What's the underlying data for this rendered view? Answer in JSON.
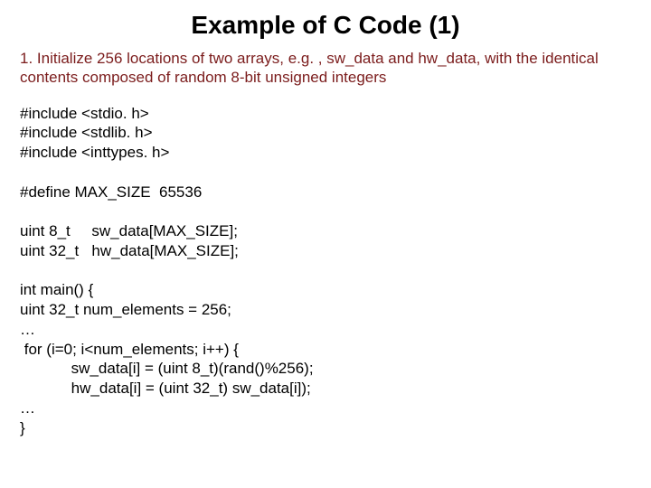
{
  "title": "Example of C Code (1)",
  "description": "1. Initialize 256 locations of two arrays, e.g. , sw_data and hw_data, with the identical contents composed of random 8-bit unsigned integers",
  "code_lines": [
    "#include <stdio. h>",
    "#include <stdlib. h>",
    "#include <inttypes. h>",
    "",
    "#define MAX_SIZE  65536",
    "",
    "uint 8_t     sw_data[MAX_SIZE];",
    "uint 32_t   hw_data[MAX_SIZE];",
    "",
    "int main() {",
    "uint 32_t num_elements = 256;",
    "…",
    " for (i=0; i<num_elements; i++) {",
    "            sw_data[i] = (uint 8_t)(rand()%256);",
    "            hw_data[i] = (uint 32_t) sw_data[i]);",
    "…",
    "}"
  ]
}
